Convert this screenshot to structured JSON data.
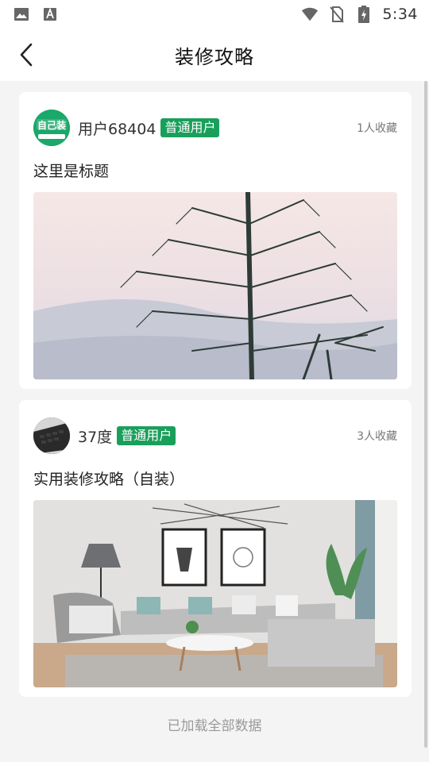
{
  "status_bar": {
    "time": "5:34",
    "left_icons": [
      "image-icon",
      "text-a-icon"
    ],
    "right_icons": [
      "wifi-icon",
      "no-sim-icon",
      "battery-charging-icon"
    ]
  },
  "header": {
    "title": "装修攻略",
    "back_icon": "chevron-left-icon"
  },
  "posts": [
    {
      "author": "用户68404",
      "badge": "普通用户",
      "favorites": "1人收藏",
      "title": "这里是标题",
      "avatar_text": "自己装",
      "image": "winter-tree-photo"
    },
    {
      "author": "37度",
      "badge": "普通用户",
      "favorites": "3人收藏",
      "title": "实用装修攻略（自装）",
      "avatar_text": "",
      "image": "living-room-photo"
    }
  ],
  "footer": {
    "load_status": "已加载全部数据"
  },
  "colors": {
    "accent": "#1a9f5b",
    "background": "#f4f4f4",
    "card": "#ffffff"
  }
}
